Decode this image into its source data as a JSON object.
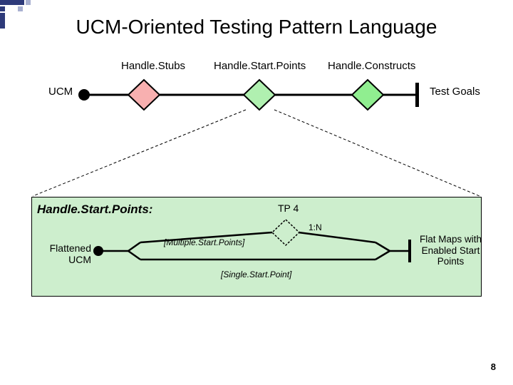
{
  "title": "UCM-Oriented Testing Pattern Language",
  "top": {
    "stubs": "Handle.Stubs",
    "startpoints": "Handle.Start.Points",
    "constructs": "Handle.Constructs",
    "ucm": "UCM",
    "goals": "Test Goals"
  },
  "detail": {
    "title": "Handle.Start.Points:",
    "tp4": "TP 4",
    "ratio": "1:N",
    "multiple": "[Multiple.Start.Points]",
    "single": "[Single.Start.Point]",
    "flattened": "Flattened UCM",
    "flatmaps": "Flat Maps with Enabled Start Points"
  },
  "page": "8",
  "colors": {
    "pink": "#f8b0b0",
    "lightgreen": "#b0f0b0",
    "green": "#90ee90",
    "boxgreen": "#cdeecd",
    "navy": "#2e3a7a"
  }
}
